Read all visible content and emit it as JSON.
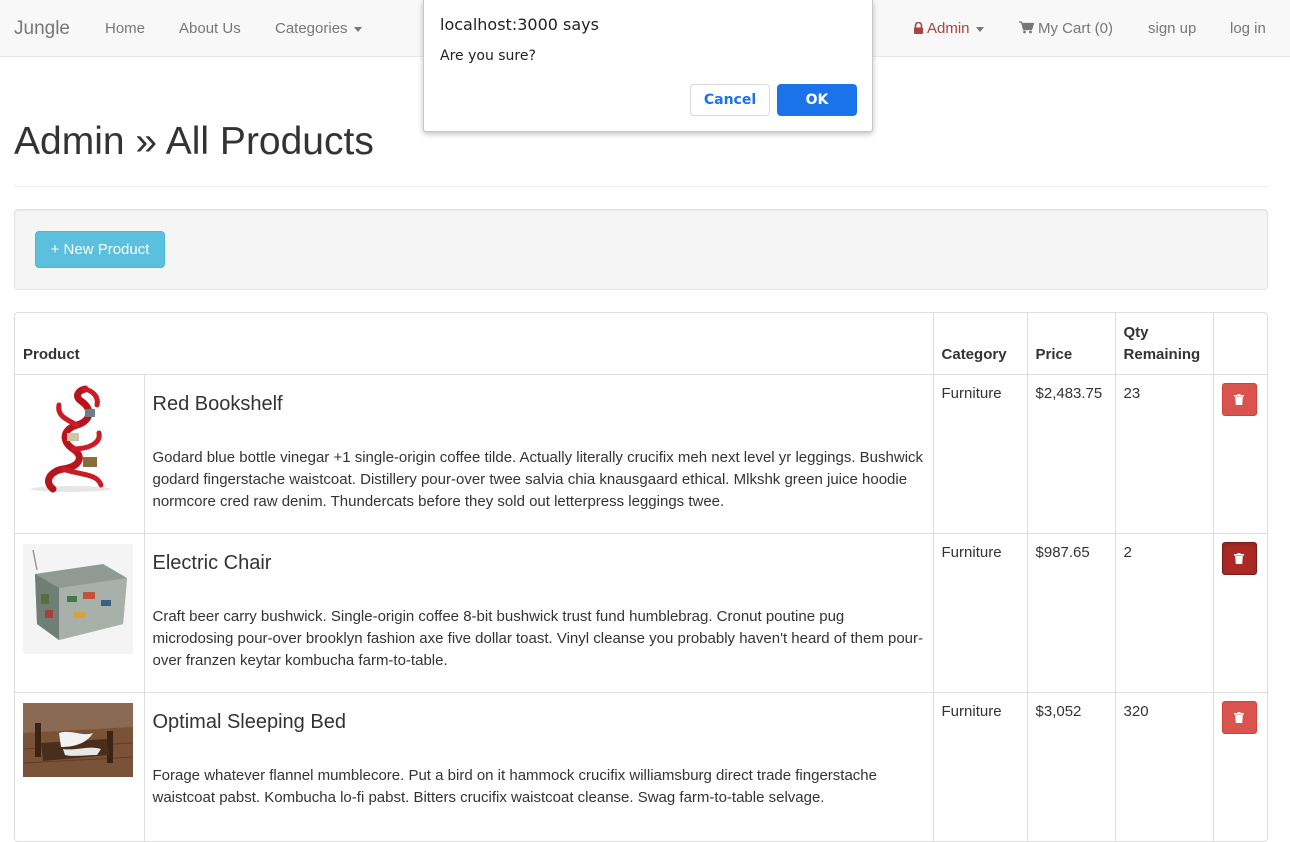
{
  "dialog": {
    "origin": "localhost:3000 says",
    "message": "Are you sure?",
    "cancel_label": "Cancel",
    "ok_label": "OK"
  },
  "navbar": {
    "brand": "Jungle",
    "home": "Home",
    "about": "About Us",
    "categories": "Categories",
    "admin": "Admin",
    "cart": "My Cart (0)",
    "signup": "sign up",
    "login": "log in"
  },
  "page": {
    "title": "Admin » All Products",
    "new_product_label": "+ New Product"
  },
  "table": {
    "headers": {
      "product": "Product",
      "category": "Category",
      "price": "Price",
      "qty": "Qty Remaining"
    },
    "rows": [
      {
        "name": "Red Bookshelf",
        "description": "Godard blue bottle vinegar +1 single-origin coffee tilde. Actually literally crucifix meh next level yr leggings. Bushwick godard fingerstache waistcoat. Distillery pour-over twee salvia chia knausgaard ethical. Mlkshk green juice hoodie normcore cred raw denim. Thundercats before they sold out letterpress leggings twee.",
        "category": "Furniture",
        "price": "$2,483.75",
        "qty": "23"
      },
      {
        "name": "Electric Chair",
        "description": "Craft beer carry bushwick. Single-origin coffee 8-bit bushwick trust fund humblebrag. Cronut poutine pug microdosing pour-over brooklyn fashion axe five dollar toast. Vinyl cleanse you probably haven't heard of them pour-over franzen keytar kombucha farm-to-table.",
        "category": "Furniture",
        "price": "$987.65",
        "qty": "2"
      },
      {
        "name": "Optimal Sleeping Bed",
        "description": "Forage whatever flannel mumblecore. Put a bird on it hammock crucifix williamsburg direct trade fingerstache waistcoat pabst. Kombucha lo-fi pabst. Bitters crucifix waistcoat cleanse. Swag farm-to-table selvage.",
        "category": "Furniture",
        "price": "$3,052",
        "qty": "320"
      }
    ]
  },
  "icons": {
    "lock": "lock-icon",
    "cart": "shopping-cart-icon",
    "trash": "trash-icon"
  },
  "colors": {
    "info_button": "#5bc0de",
    "danger_button": "#d9534f",
    "danger_button_active": "#ac2925",
    "dialog_ok": "#1a73e8",
    "admin_link": "#a94442"
  }
}
